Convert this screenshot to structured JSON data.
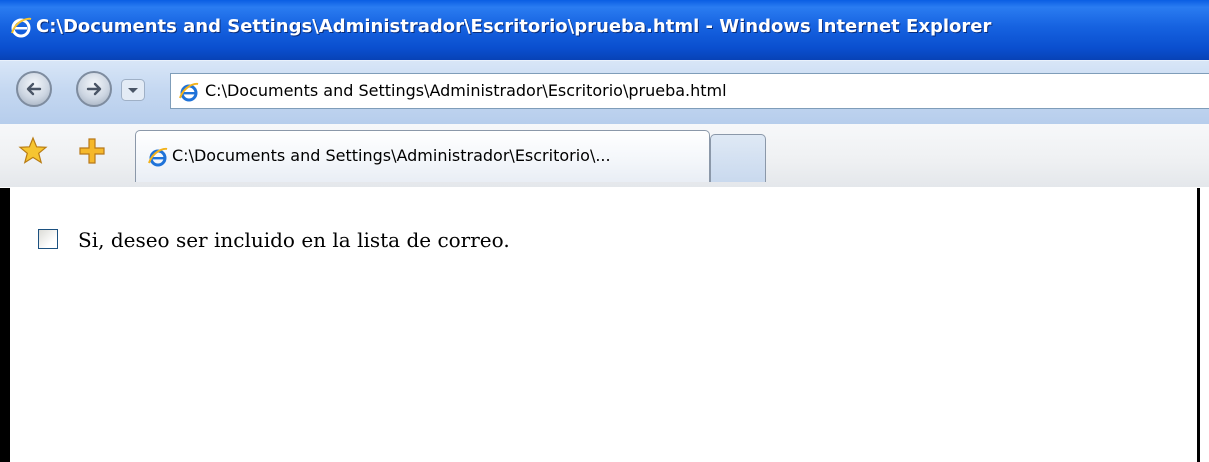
{
  "window": {
    "title": "C:\\Documents and Settings\\Administrador\\Escritorio\\prueba.html - Windows Internet Explorer",
    "title_icon": "ie-icon",
    "titlebar_color": "#0a4fcf"
  },
  "navigation": {
    "back_icon": "back-arrow-icon",
    "forward_icon": "forward-arrow-icon",
    "dropdown_icon": "chevron-down-icon",
    "address": "C:\\Documents and Settings\\Administrador\\Escritorio\\prueba.html"
  },
  "toolbar": {
    "favorites_icon": "star-icon",
    "add_favorite_icon": "plus-icon"
  },
  "tabs": [
    {
      "label": "C:\\Documents and Settings\\Administrador\\Escritorio\\...",
      "active": true
    },
    {
      "label": "",
      "new_tab": true
    }
  ],
  "page": {
    "checkbox": {
      "label": "Si, deseo ser incluido en la lista de correo.",
      "checked": false
    }
  }
}
